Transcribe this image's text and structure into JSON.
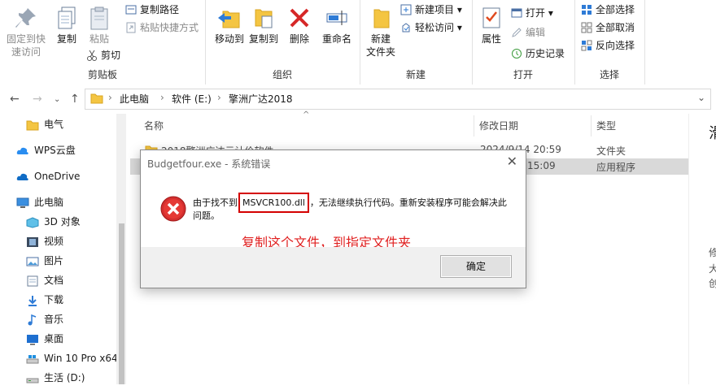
{
  "ribbon": {
    "clipboard": {
      "pin": "固定到快\n速访问",
      "copy": "复制",
      "paste": "粘贴",
      "copy_path": "复制路径",
      "paste_shortcut": "粘贴快捷方式",
      "cut": "剪切",
      "label": "剪贴板"
    },
    "organize": {
      "move_to": "移动到",
      "copy_to": "复制到",
      "delete": "删除",
      "rename": "重命名",
      "label": "组织"
    },
    "new": {
      "new_folder": "新建\n文件夹",
      "new_item": "新建项目",
      "easy_access": "轻松访问",
      "label": "新建"
    },
    "open": {
      "properties": "属性",
      "open": "打开",
      "edit": "编辑",
      "history": "历史记录",
      "label": "打开"
    },
    "select": {
      "select_all": "全部选择",
      "select_none": "全部取消",
      "invert": "反向选择",
      "label": "选择"
    }
  },
  "address": {
    "crumbs": [
      "此电脑",
      "软件 (E:)",
      "擎洲广达2018"
    ]
  },
  "nav": {
    "items": [
      "电气",
      "WPS云盘",
      "OneDrive",
      "此电脑",
      "3D 对象",
      "视频",
      "图片",
      "文档",
      "下载",
      "音乐",
      "桌面",
      "Win 10 Pro x64",
      "生活 (D:)"
    ]
  },
  "columns": {
    "name": "名称",
    "date": "修改日期",
    "type": "类型"
  },
  "files": [
    {
      "name": "2018擎洲广达云计价软件",
      "date": "2024/9/14 20:59",
      "type": "文件夹"
    },
    {
      "name": "",
      "date": "15:09",
      "type": "应用程序"
    }
  ],
  "right_panel": {
    "top": "滑",
    "lines": [
      "修",
      "大",
      "创"
    ]
  },
  "dialog": {
    "title": "Budgetfour.exe - 系统错误",
    "msg_before": "由于找不到",
    "msg_dll": "MSVCR100.dll",
    "msg_after": "，无法继续执行代码。重新安装程序可能会解决此问题。",
    "annotation": "复制这个文件，到指定文件夹",
    "ok": "确定"
  }
}
